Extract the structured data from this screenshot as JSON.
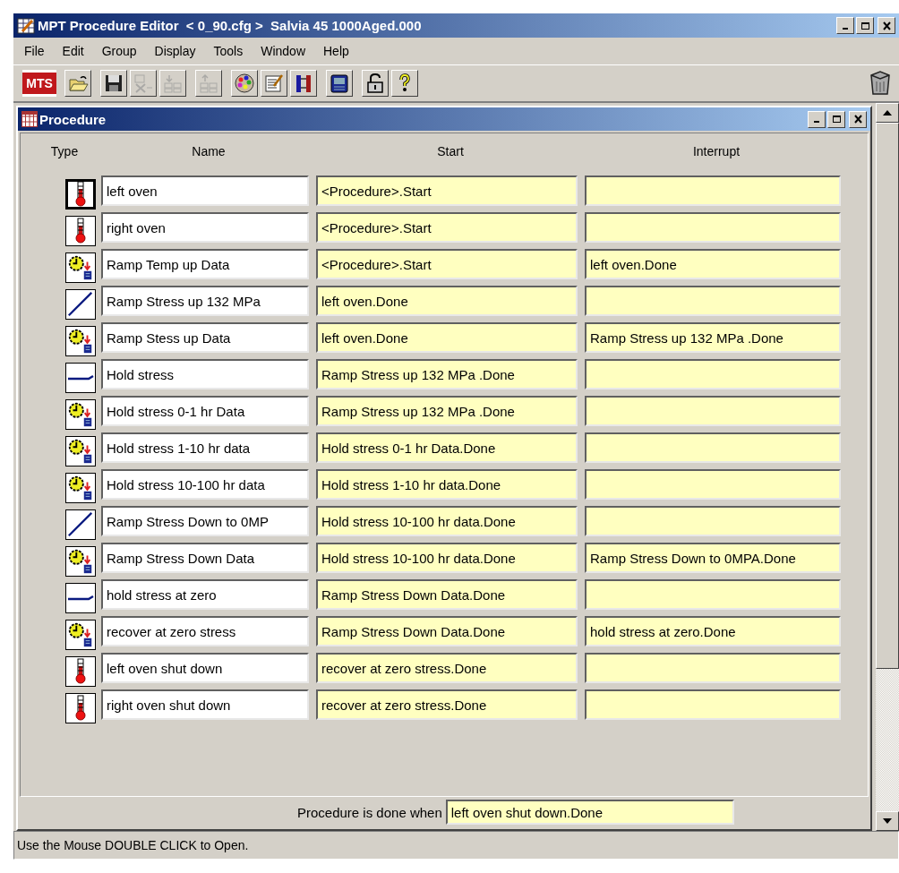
{
  "window": {
    "title": "MPT Procedure Editor  < 0_90.cfg >  Salvia 45 1000Aged.000"
  },
  "menu": [
    {
      "label": "File"
    },
    {
      "label": "Edit"
    },
    {
      "label": "Group"
    },
    {
      "label": "Display"
    },
    {
      "label": "Tools"
    },
    {
      "label": "Window"
    },
    {
      "label": "Help"
    }
  ],
  "toolbar": [
    {
      "kind": "logo",
      "label": "MTS",
      "disabled": false
    },
    {
      "kind": "open",
      "disabled": false
    },
    {
      "kind": "save",
      "disabled": false
    },
    {
      "kind": "cut",
      "disabled": true
    },
    {
      "kind": "group-down",
      "disabled": true
    },
    {
      "kind": "group-up",
      "disabled": true
    },
    {
      "kind": "palette",
      "disabled": false
    },
    {
      "kind": "edit",
      "disabled": false
    },
    {
      "kind": "bars",
      "disabled": false
    },
    {
      "kind": "book",
      "disabled": false
    },
    {
      "kind": "lock",
      "disabled": false
    },
    {
      "kind": "help",
      "disabled": false
    }
  ],
  "child_window": {
    "title": "Procedure"
  },
  "table": {
    "columns": [
      "Type",
      "Name",
      "Start",
      "Interrupt"
    ],
    "rows": [
      {
        "kind": "temperature",
        "selected": true,
        "name": "left oven",
        "start": "<Procedure>.Start",
        "interrupt": ""
      },
      {
        "kind": "temperature",
        "selected": false,
        "name": "right oven",
        "start": "<Procedure>.Start",
        "interrupt": ""
      },
      {
        "kind": "data",
        "selected": false,
        "name": "Ramp Temp up Data",
        "start": "<Procedure>.Start",
        "interrupt": "left oven.Done"
      },
      {
        "kind": "ramp",
        "selected": false,
        "name": "Ramp Stress up 132 MPa",
        "start": "left oven.Done",
        "interrupt": ""
      },
      {
        "kind": "data",
        "selected": false,
        "name": "Ramp Stess up Data",
        "start": "left oven.Done",
        "interrupt": "Ramp Stress up 132 MPa .Done"
      },
      {
        "kind": "hold",
        "selected": false,
        "name": "Hold stress",
        "start": "Ramp Stress up 132 MPa .Done",
        "interrupt": ""
      },
      {
        "kind": "data",
        "selected": false,
        "name": "Hold stress 0-1 hr Data",
        "start": "Ramp Stress up 132 MPa .Done",
        "interrupt": ""
      },
      {
        "kind": "data",
        "selected": false,
        "name": "Hold stress 1-10 hr data",
        "start": "Hold stress 0-1 hr Data.Done",
        "interrupt": ""
      },
      {
        "kind": "data",
        "selected": false,
        "name": "Hold stress 10-100 hr data",
        "start": "Hold stress 1-10 hr data.Done",
        "interrupt": ""
      },
      {
        "kind": "ramp",
        "selected": false,
        "name": "Ramp Stress Down to 0MP",
        "start": "Hold stress 10-100 hr data.Done",
        "interrupt": ""
      },
      {
        "kind": "data",
        "selected": false,
        "name": "Ramp Stress Down Data",
        "start": "Hold stress 10-100 hr data.Done",
        "interrupt": "Ramp Stress Down to 0MPA.Done"
      },
      {
        "kind": "hold",
        "selected": false,
        "name": "hold stress at zero",
        "start": "Ramp Stress Down Data.Done",
        "interrupt": ""
      },
      {
        "kind": "data",
        "selected": false,
        "name": "recover at zero stress",
        "start": "Ramp Stress Down Data.Done",
        "interrupt": "hold stress at zero.Done"
      },
      {
        "kind": "temperature",
        "selected": false,
        "name": "left oven shut down",
        "start": "recover at zero stress.Done",
        "interrupt": ""
      },
      {
        "kind": "temperature",
        "selected": false,
        "name": "right oven shut down",
        "start": "recover at zero stress.Done",
        "interrupt": ""
      }
    ]
  },
  "done_when": {
    "label": "Procedure is done when",
    "value": "left oven shut down.Done"
  },
  "status_bar": "Use the Mouse DOUBLE CLICK to Open."
}
